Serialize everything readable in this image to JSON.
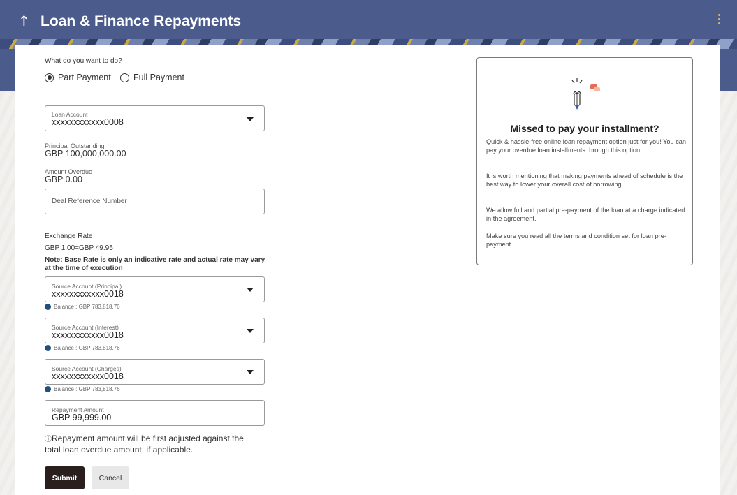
{
  "header": {
    "title": "Loan & Finance Repayments",
    "back_icon": "arrow-up-icon",
    "menu_icon": "kebab-menu-icon"
  },
  "form": {
    "question": "What do you want to do?",
    "payment_options": [
      {
        "label": "Part Payment",
        "selected": true
      },
      {
        "label": "Full Payment",
        "selected": false
      }
    ],
    "loan_account": {
      "label": "Loan Account",
      "value": "xxxxxxxxxxxx0008"
    },
    "principal_outstanding": {
      "label": "Principal Outstanding",
      "value": "GBP 100,000,000.00"
    },
    "amount_overdue": {
      "label": "Amount Overdue",
      "value": "GBP 0.00"
    },
    "deal_reference": {
      "placeholder": "Deal Reference Number"
    },
    "exchange_rate": {
      "label": "Exchange Rate",
      "value": "GBP 1.00=GBP 49.95",
      "note": "Note: Base Rate is only an indicative rate and actual rate may vary at the time of execution"
    },
    "source_principal": {
      "label": "Source Account (Principal)",
      "value": "xxxxxxxxxxxx0018",
      "balance": "Balance : GBP 783,818.76"
    },
    "source_interest": {
      "label": "Source Account (Interest)",
      "value": "xxxxxxxxxxxx0018",
      "balance": "Balance : GBP 783,818.76"
    },
    "source_charges": {
      "label": "Source Account (Charges)",
      "value": "xxxxxxxxxxxx0018",
      "balance": "Balance : GBP 783,818.76"
    },
    "repayment_amount": {
      "label": "Repayment Amount",
      "value": "GBP 99,999.00"
    },
    "hint": "Repayment amount will be first adjusted against the total loan overdue amount, if applicable.",
    "submit_label": "Submit",
    "cancel_label": "Cancel"
  },
  "info_panel": {
    "title": "Missed to pay your installment?",
    "paragraphs": [
      "Quick & hassle-free online loan repayment option just for you! You can pay your overdue loan installments through this option.",
      "It is worth mentioning that making payments ahead of schedule is the best way to lower your overall cost of borrowing.",
      "We allow full and partial pre-payment of the loan at a charge indicated in the agreement.",
      "Make sure you read all the terms and condition set for loan pre-payment."
    ]
  },
  "colors": {
    "header": "#4a5b8c",
    "submit": "#2a1f1c",
    "info_icon": "#1f4f7a",
    "accent": "#e0b84a"
  }
}
